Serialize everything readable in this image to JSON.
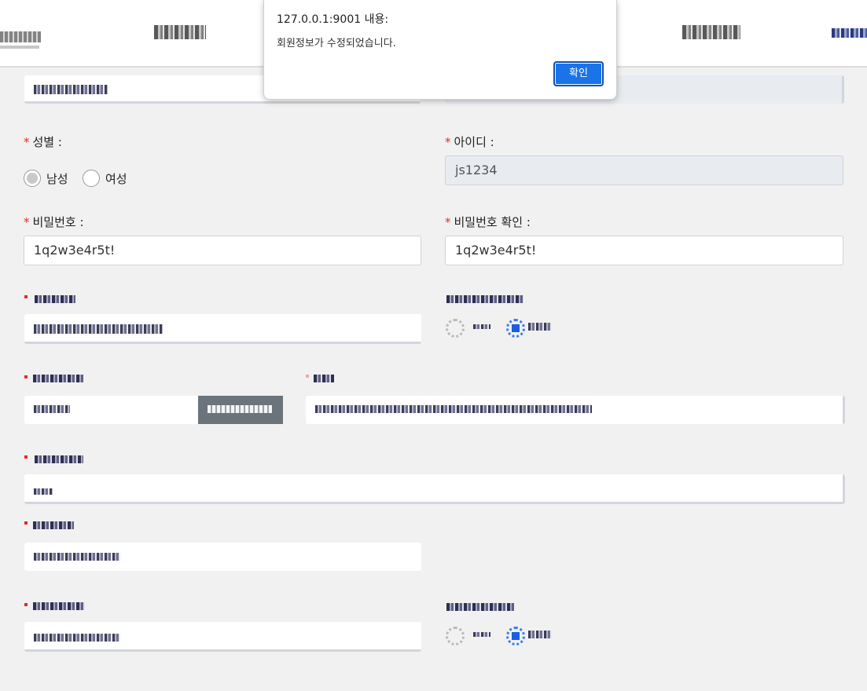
{
  "dialog": {
    "title": "127.0.0.1:9001 내용:",
    "message": "회원정보가 수정되었습니다.",
    "ok_label": "확인"
  },
  "form": {
    "gender": {
      "label": "성별 :",
      "required_mark": "*",
      "options": [
        "남성",
        "여성"
      ],
      "selected": "남성"
    },
    "user_id": {
      "label": "아이디 :",
      "required_mark": "*",
      "value": "js1234"
    },
    "password": {
      "label": "비밀번호 :",
      "required_mark": "*",
      "value": "1q2w3e4r5t!"
    },
    "password_confirm": {
      "label": "비밀번호 확인 :",
      "required_mark": "*",
      "value": "1q2w3e4r5t!"
    }
  },
  "colors": {
    "accent": "#1a73e8",
    "required": "#e22a2a",
    "readonly_bg": "#e8ebef",
    "page_bg": "#f1f1f1"
  }
}
